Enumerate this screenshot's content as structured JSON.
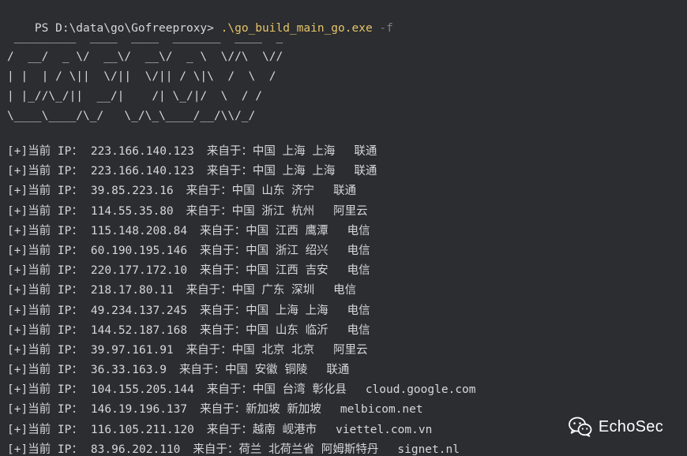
{
  "prompt": {
    "path": "PS D:\\data\\go\\Gofreeproxy> ",
    "command": ".\\go_build_main_go.exe",
    "flag": " -f"
  },
  "banner": " _________  ____  ____  _______  ____  _\n/  __/  _ \\/  __\\/  __\\/  _ \\  \\//\\  \\//\n| |  | / \\||  \\/||  \\/|| / \\|\\  /  \\  / \n| |_//\\_/||  __/|    /| \\_/|/  \\  / / \n\\____\\____/\\_/   \\_/\\_\\____/__/\\\\/_/  ",
  "labels": {
    "prefix": "[+]",
    "current_ip": "当前 IP：",
    "from": "来自于："
  },
  "rows": [
    {
      "ip": "223.166.140.123",
      "location": "中国 上海 上海",
      "isp": "联通"
    },
    {
      "ip": "223.166.140.123",
      "location": "中国 上海 上海",
      "isp": "联通"
    },
    {
      "ip": "39.85.223.16",
      "location": "中国 山东 济宁",
      "isp": "联通"
    },
    {
      "ip": "114.55.35.80",
      "location": "中国 浙江 杭州",
      "isp": "阿里云"
    },
    {
      "ip": "115.148.208.84",
      "location": "中国 江西 鹰潭",
      "isp": "电信"
    },
    {
      "ip": "60.190.195.146",
      "location": "中国 浙江 绍兴",
      "isp": "电信"
    },
    {
      "ip": "220.177.172.10",
      "location": "中国 江西 吉安",
      "isp": "电信"
    },
    {
      "ip": "218.17.80.11",
      "location": "中国 广东 深圳",
      "isp": "电信"
    },
    {
      "ip": "49.234.137.245",
      "location": "中国 上海 上海",
      "isp": "电信"
    },
    {
      "ip": "144.52.187.168",
      "location": "中国 山东 临沂",
      "isp": "电信"
    },
    {
      "ip": "39.97.161.91",
      "location": "中国 北京 北京",
      "isp": "阿里云"
    },
    {
      "ip": "36.33.163.9",
      "location": "中国 安徽 铜陵",
      "isp": "联通"
    },
    {
      "ip": "104.155.205.144",
      "location": "中国 台湾 彰化县",
      "isp": "cloud.google.com"
    },
    {
      "ip": "146.19.196.137",
      "location": "新加坡 新加坡",
      "isp": "melbicom.net"
    },
    {
      "ip": "116.105.211.120",
      "location": "越南 岘港市",
      "isp": "viettel.com.vn"
    },
    {
      "ip": "83.96.202.110",
      "location": "荷兰 北荷兰省 阿姆斯特丹",
      "isp": "signet.nl"
    }
  ],
  "watermark": {
    "text": "EchoSec",
    "icon": "wechat-icon"
  }
}
